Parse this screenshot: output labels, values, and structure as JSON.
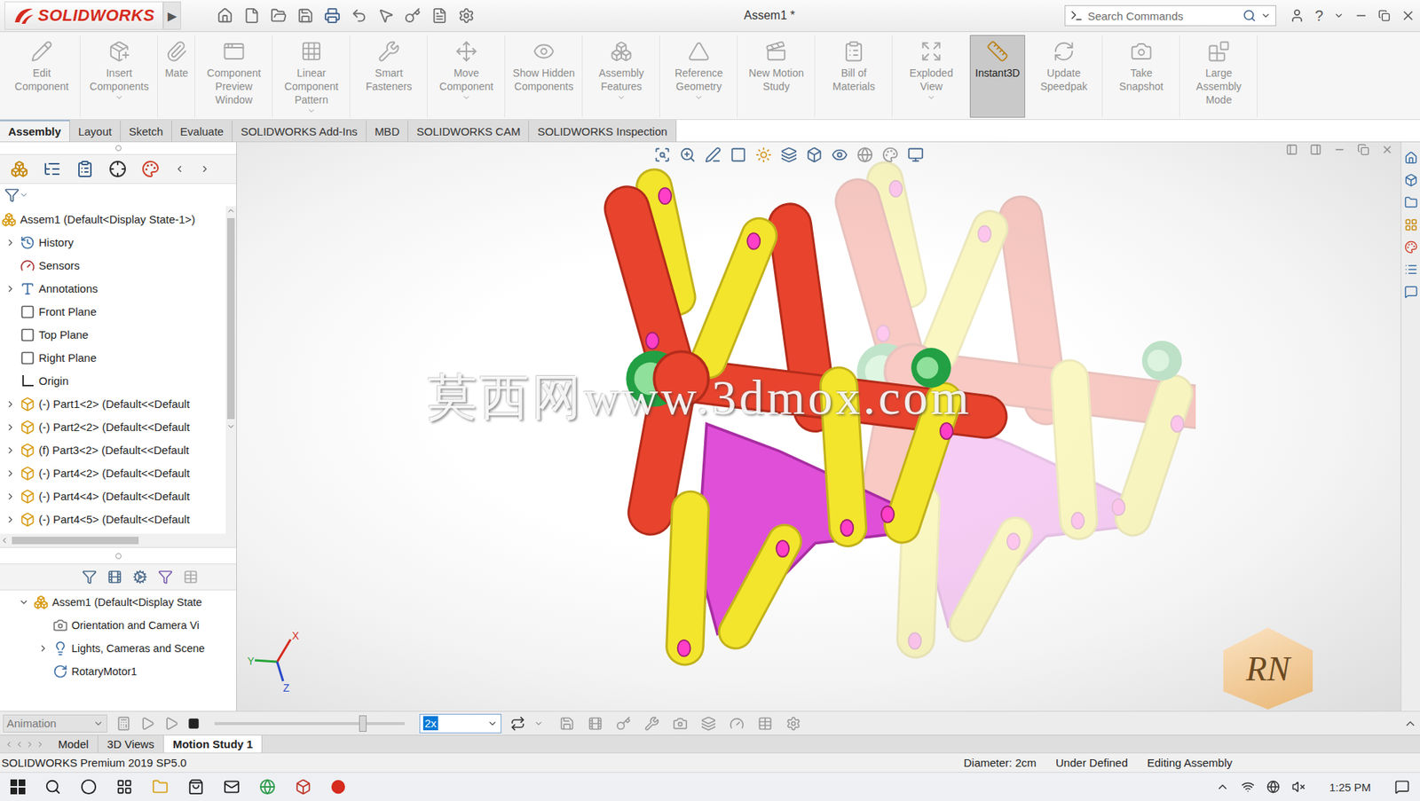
{
  "window": {
    "app": "SOLIDWORKS",
    "menu_arrow": "▶",
    "title": "Assem1 *",
    "help": "?"
  },
  "search": {
    "placeholder": "Search Commands"
  },
  "commands": [
    {
      "label": "Edit Component",
      "disabled": true,
      "selected": false,
      "dropdown": false
    },
    {
      "label": "Insert Components",
      "disabled": true,
      "selected": false,
      "dropdown": true
    },
    {
      "label": "Mate",
      "disabled": true,
      "selected": false,
      "dropdown": false
    },
    {
      "label": "Component Preview Window",
      "disabled": true,
      "selected": false,
      "dropdown": false
    },
    {
      "label": "Linear Component Pattern",
      "disabled": true,
      "selected": false,
      "dropdown": true
    },
    {
      "label": "Smart Fasteners",
      "disabled": true,
      "selected": false,
      "dropdown": false
    },
    {
      "label": "Move Component",
      "disabled": true,
      "selected": false,
      "dropdown": true
    },
    {
      "label": "Show Hidden Components",
      "disabled": true,
      "selected": false,
      "dropdown": false
    },
    {
      "label": "Assembly Features",
      "disabled": true,
      "selected": false,
      "dropdown": true
    },
    {
      "label": "Reference Geometry",
      "disabled": true,
      "selected": false,
      "dropdown": true
    },
    {
      "label": "New Motion Study",
      "disabled": true,
      "selected": false,
      "dropdown": false
    },
    {
      "label": "Bill of Materials",
      "disabled": true,
      "selected": false,
      "dropdown": false
    },
    {
      "label": "Exploded View",
      "disabled": true,
      "selected": false,
      "dropdown": true
    },
    {
      "label": "Instant3D",
      "disabled": false,
      "selected": true,
      "dropdown": false
    },
    {
      "label": "Update Speedpak",
      "disabled": true,
      "selected": false,
      "dropdown": false
    },
    {
      "label": "Take Snapshot",
      "disabled": true,
      "selected": false,
      "dropdown": false
    },
    {
      "label": "Large Assembly Mode",
      "disabled": true,
      "selected": false,
      "dropdown": false
    }
  ],
  "tabs": [
    {
      "label": "Assembly",
      "selected": true
    },
    {
      "label": "Layout",
      "selected": false
    },
    {
      "label": "Sketch",
      "selected": false
    },
    {
      "label": "Evaluate",
      "selected": false
    },
    {
      "label": "SOLIDWORKS Add-Ins",
      "selected": false
    },
    {
      "label": "MBD",
      "selected": false
    },
    {
      "label": "SOLIDWORKS CAM",
      "selected": false
    },
    {
      "label": "SOLIDWORKS Inspection",
      "selected": false
    }
  ],
  "feature_tree": {
    "items": [
      {
        "label": "Assem1  (Default<Display State-1>)",
        "kind": "assembly",
        "depth": 0,
        "expandable": false,
        "expanded": true
      },
      {
        "label": "History",
        "kind": "folder",
        "depth": 1,
        "expandable": true,
        "expanded": false
      },
      {
        "label": "Sensors",
        "kind": "sensor",
        "depth": 1,
        "expandable": false,
        "expanded": false
      },
      {
        "label": "Annotations",
        "kind": "annotation",
        "depth": 1,
        "expandable": true,
        "expanded": false
      },
      {
        "label": "Front Plane",
        "kind": "plane",
        "depth": 1,
        "expandable": false,
        "expanded": false
      },
      {
        "label": "Top Plane",
        "kind": "plane",
        "depth": 1,
        "expandable": false,
        "expanded": false
      },
      {
        "label": "Right Plane",
        "kind": "plane",
        "depth": 1,
        "expandable": false,
        "expanded": false
      },
      {
        "label": "Origin",
        "kind": "origin",
        "depth": 1,
        "expandable": false,
        "expanded": false
      },
      {
        "label": "(-) Part1<2> (Default<<Default",
        "kind": "part",
        "depth": 1,
        "expandable": true,
        "expanded": false
      },
      {
        "label": "(-) Part2<2> (Default<<Default",
        "kind": "part",
        "depth": 1,
        "expandable": true,
        "expanded": false
      },
      {
        "label": "(f) Part3<2> (Default<<Default",
        "kind": "part",
        "depth": 1,
        "expandable": true,
        "expanded": false
      },
      {
        "label": "(-) Part4<2> (Default<<Default",
        "kind": "part",
        "depth": 1,
        "expandable": true,
        "expanded": false
      },
      {
        "label": "(-) Part4<4> (Default<<Default",
        "kind": "part",
        "depth": 1,
        "expandable": true,
        "expanded": false
      },
      {
        "label": "(-) Part4<5> (Default<<Default",
        "kind": "part",
        "depth": 1,
        "expandable": true,
        "expanded": false
      }
    ]
  },
  "motion_tree": {
    "items": [
      {
        "label": "Assem1  (Default<Display State",
        "kind": "assembly",
        "depth": 0,
        "expandable": true,
        "expanded": true
      },
      {
        "label": "Orientation and Camera Vi",
        "kind": "camera",
        "depth": 1,
        "expandable": false,
        "expanded": false
      },
      {
        "label": "Lights, Cameras and Scene",
        "kind": "lights",
        "depth": 1,
        "expandable": true,
        "expanded": false
      },
      {
        "label": "RotaryMotor1",
        "kind": "motor",
        "depth": 1,
        "expandable": false,
        "expanded": false
      }
    ]
  },
  "motion_bar": {
    "study_type": "Animation",
    "speed": "2x",
    "timeline": {
      "level": 0.78
    }
  },
  "bottom_tabs": [
    {
      "label": "Model",
      "selected": false
    },
    {
      "label": "3D Views",
      "selected": false
    },
    {
      "label": "Motion Study 1",
      "selected": true
    }
  ],
  "status_bar": {
    "product": "SOLIDWORKS Premium 2019 SP5.0",
    "fields": [
      "Diameter: 2cm",
      "Under Defined",
      "Editing Assembly"
    ]
  },
  "viewport": {
    "watermark": "莫西网www.3dmox.com",
    "logo": "RN",
    "triad": [
      "X",
      "Y",
      "Z"
    ]
  },
  "taskbar": {
    "time": "1:25 PM"
  }
}
